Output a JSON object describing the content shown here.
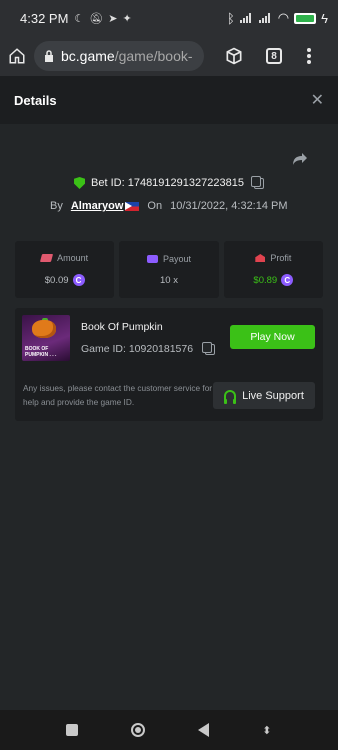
{
  "statusbar": {
    "time": "4:32 PM",
    "battery": "69"
  },
  "browser": {
    "url_host": "bc.game",
    "url_path": "/game/book-",
    "tab_count": "8"
  },
  "modal": {
    "title": "Details",
    "close_glyph": "✕"
  },
  "bet": {
    "id_label": "Bet ID: 1748191291327223815",
    "by_label": "By",
    "user": "Almaryow",
    "on_label": "On",
    "datetime": "10/31/2022, 4:32:14 PM"
  },
  "stats": [
    {
      "label": "Amount",
      "value": "$0.09",
      "icon": "amount-icon"
    },
    {
      "label": "Payout",
      "value": "10 x",
      "icon": "payout-icon"
    },
    {
      "label": "Profit",
      "value": "$0.89",
      "icon": "profit-icon"
    }
  ],
  "coin_glyph": "C",
  "game": {
    "name": "Book Of Pumpkin",
    "id_label": "Game ID: 10920181576",
    "thumb_text": "BOOK OF PUMPKIN . . .",
    "play_label": "Play Now"
  },
  "support": {
    "help_text": "Any issues, please contact the customer service for help and provide the game ID.",
    "live_label": "Live Support"
  },
  "colors": {
    "accent_green": "#3bc117",
    "coin_purple": "#8c5cff",
    "bg": "#232628",
    "card": "#1c1e20"
  }
}
